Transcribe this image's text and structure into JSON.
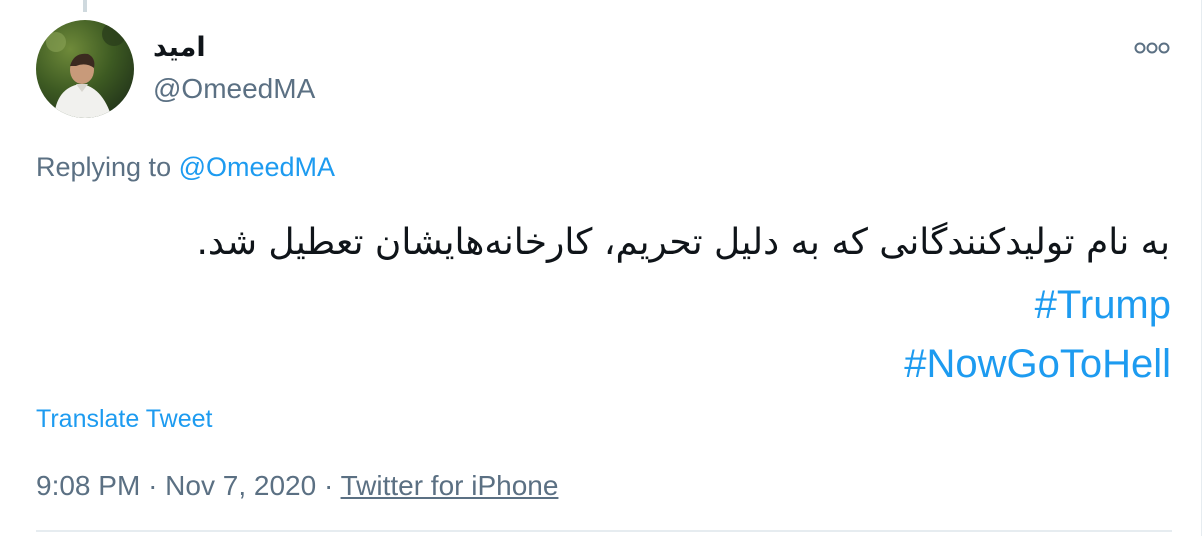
{
  "tweet": {
    "author": {
      "display_name": "امید",
      "handle": "@OmeedMA",
      "avatar_icon": "profile-photo"
    },
    "more_icon": "more-options-icon",
    "replying_prefix": "Replying to",
    "replying_to": "@OmeedMA",
    "text": "به نام تولیدکنندگانی که به دلیل تحریم، کارخانه‌هایشان تعطیل شد.",
    "hashtags": [
      "#Trump",
      "#NowGoToHell"
    ],
    "translate_label": "Translate Tweet",
    "time": "9:08 PM",
    "separator": "·",
    "date": "Nov 7, 2020",
    "source": "Twitter for iPhone"
  },
  "colors": {
    "link": "#1d9bf0",
    "secondary_text": "#5b7083",
    "primary_text": "#0f1419",
    "border": "#e6ecf0"
  }
}
